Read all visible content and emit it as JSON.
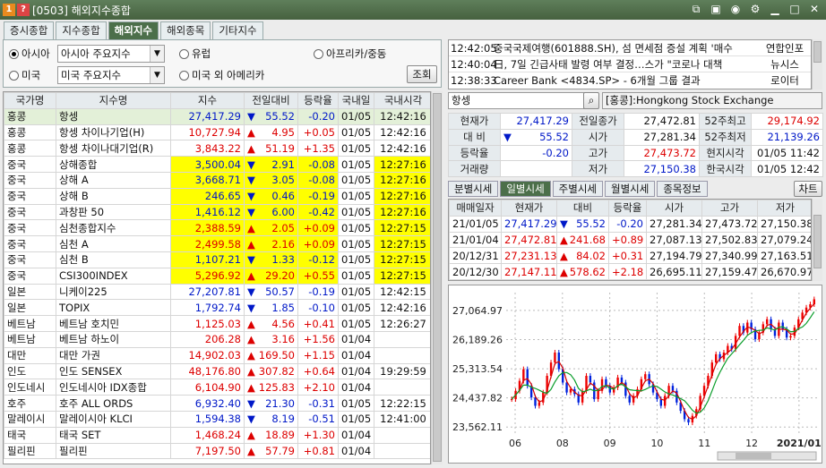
{
  "window": {
    "screen_no": "[0503]",
    "title": "해외지수종합"
  },
  "tabs": [
    "증시종합",
    "지수종합",
    "해외지수",
    "해외종목",
    "기타지수"
  ],
  "active_tab": 2,
  "regions": {
    "asia": "아시아",
    "europe": "유럽",
    "africa": "아프리카/중동",
    "usa": "미국",
    "usa_other": "미국 외 아메리카",
    "asia_select": "아시아 주요지수",
    "usa_select": "미국 주요지수",
    "query_button": "조회"
  },
  "table": {
    "headers": [
      "국가명",
      "지수명",
      "지수",
      "전일대비",
      "등락율",
      "국내일",
      "국내시각"
    ],
    "rows": [
      {
        "country": "홍콩",
        "name": "항셍",
        "value": "27,417.29",
        "dir": "down",
        "change": "55.52",
        "rate": "-0.20",
        "date": "01/05",
        "time": "12:42:16",
        "yellow": false,
        "hl": true
      },
      {
        "country": "홍콩",
        "name": "항셍 차이나기업(H)",
        "value": "10,727.94",
        "dir": "up",
        "change": "4.95",
        "rate": "+0.05",
        "date": "01/05",
        "time": "12:42:16",
        "yellow": false
      },
      {
        "country": "홍콩",
        "name": "항셍 차이나대기업(R)",
        "value": "3,843.22",
        "dir": "up",
        "change": "51.19",
        "rate": "+1.35",
        "date": "01/05",
        "time": "12:42:16",
        "yellow": false
      },
      {
        "country": "중국",
        "name": "상해종합",
        "value": "3,500.04",
        "dir": "down",
        "change": "2.91",
        "rate": "-0.08",
        "date": "01/05",
        "time": "12:27:16",
        "yellow": true
      },
      {
        "country": "중국",
        "name": "상해 A",
        "value": "3,668.71",
        "dir": "down",
        "change": "3.05",
        "rate": "-0.08",
        "date": "01/05",
        "time": "12:27:16",
        "yellow": true
      },
      {
        "country": "중국",
        "name": "상해 B",
        "value": "246.65",
        "dir": "down",
        "change": "0.46",
        "rate": "-0.19",
        "date": "01/05",
        "time": "12:27:16",
        "yellow": true
      },
      {
        "country": "중국",
        "name": "과창판 50",
        "value": "1,416.12",
        "dir": "down",
        "change": "6.00",
        "rate": "-0.42",
        "date": "01/05",
        "time": "12:27:16",
        "yellow": true
      },
      {
        "country": "중국",
        "name": "심천종합지수",
        "value": "2,388.59",
        "dir": "up",
        "change": "2.05",
        "rate": "+0.09",
        "date": "01/05",
        "time": "12:27:15",
        "yellow": true
      },
      {
        "country": "중국",
        "name": "심천 A",
        "value": "2,499.58",
        "dir": "up",
        "change": "2.16",
        "rate": "+0.09",
        "date": "01/05",
        "time": "12:27:15",
        "yellow": true
      },
      {
        "country": "중국",
        "name": "심천 B",
        "value": "1,107.21",
        "dir": "down",
        "change": "1.33",
        "rate": "-0.12",
        "date": "01/05",
        "time": "12:27:15",
        "yellow": true
      },
      {
        "country": "중국",
        "name": "CSI300INDEX",
        "value": "5,296.92",
        "dir": "up",
        "change": "29.20",
        "rate": "+0.55",
        "date": "01/05",
        "time": "12:27:15",
        "yellow": true
      },
      {
        "country": "일본",
        "name": "니케이225",
        "value": "27,207.81",
        "dir": "down",
        "change": "50.57",
        "rate": "-0.19",
        "date": "01/05",
        "time": "12:42:15",
        "yellow": false
      },
      {
        "country": "일본",
        "name": "TOPIX",
        "value": "1,792.74",
        "dir": "down",
        "change": "1.85",
        "rate": "-0.10",
        "date": "01/05",
        "time": "12:42:16",
        "yellow": false
      },
      {
        "country": "베트남",
        "name": "베트남 호치민",
        "value": "1,125.03",
        "dir": "up",
        "change": "4.56",
        "rate": "+0.41",
        "date": "01/05",
        "time": "12:26:27",
        "yellow": false
      },
      {
        "country": "베트남",
        "name": "베트남 하노이",
        "value": "206.28",
        "dir": "up",
        "change": "3.16",
        "rate": "+1.56",
        "date": "01/04",
        "time": "",
        "yellow": false
      },
      {
        "country": "대만",
        "name": "대만 가권",
        "value": "14,902.03",
        "dir": "up",
        "change": "169.50",
        "rate": "+1.15",
        "date": "01/04",
        "time": "",
        "yellow": false
      },
      {
        "country": "인도",
        "name": "인도 SENSEX",
        "value": "48,176.80",
        "dir": "up",
        "change": "307.82",
        "rate": "+0.64",
        "date": "01/04",
        "time": "19:29:59",
        "yellow": false
      },
      {
        "country": "인도네시",
        "name": "인도네시아 IDX종합",
        "value": "6,104.90",
        "dir": "up",
        "change": "125.83",
        "rate": "+2.10",
        "date": "01/04",
        "time": "",
        "yellow": false
      },
      {
        "country": "호주",
        "name": "호주 ALL ORDS",
        "value": "6,932.40",
        "dir": "down",
        "change": "21.30",
        "rate": "-0.31",
        "date": "01/05",
        "time": "12:22:15",
        "yellow": false
      },
      {
        "country": "말레이시",
        "name": "말레이시아 KLCI",
        "value": "1,594.38",
        "dir": "down",
        "change": "8.19",
        "rate": "-0.51",
        "date": "01/05",
        "time": "12:41:00",
        "yellow": false
      },
      {
        "country": "태국",
        "name": "태국 SET",
        "value": "1,468.24",
        "dir": "up",
        "change": "18.89",
        "rate": "+1.30",
        "date": "01/04",
        "time": "",
        "yellow": false
      },
      {
        "country": "필리핀",
        "name": "필리핀",
        "value": "7,197.50",
        "dir": "up",
        "change": "57.79",
        "rate": "+0.81",
        "date": "01/04",
        "time": "",
        "yellow": false
      }
    ]
  },
  "news": [
    {
      "time": "12:42:05",
      "headline": "중국국제여행(601888.SH), 섬 면세점 증설 계획 '매수",
      "source": "연합인포"
    },
    {
      "time": "12:40:04",
      "headline": "日, 7일 긴급사태 발령 여부 결정…스가 \"코로나 대책",
      "source": "뉴시스"
    },
    {
      "time": "12:38:33",
      "headline": "Career Bank <4834.SP> - 6개월 그룹 결과",
      "source": "로이터"
    }
  ],
  "detail": {
    "search_value": "항셍",
    "exchange": "[홍콩]:Hongkong Stock Exchange",
    "labels": {
      "cur": "현재가",
      "diff": "대 비",
      "rate": "등락율",
      "vol": "거래량",
      "prev": "전일종가",
      "open": "시가",
      "high": "고가",
      "low": "저가",
      "w52h": "52주최고",
      "w52l": "52주최저",
      "local": "현지시각",
      "kr": "한국시각"
    },
    "cur": "27,417.29",
    "diff": "55.52",
    "rate": "-0.20",
    "vol": "",
    "prev": "27,472.81",
    "open": "27,281.34",
    "high": "27,473.72",
    "low": "27,150.38",
    "w52h": "29,174.92",
    "w52l": "21,139.26",
    "local": "01/05 11:42",
    "kr": "01/05 12:42"
  },
  "subtabs": [
    "분별시세",
    "일별시세",
    "주별시세",
    "월별시세",
    "종목정보"
  ],
  "active_subtab": 1,
  "chart_button": "차트",
  "daily": {
    "headers": [
      "매매일자",
      "현재가",
      "대비",
      "등락율",
      "시가",
      "고가",
      "저가"
    ],
    "rows": [
      {
        "date": "21/01/05",
        "cur": "27,417.29",
        "dir": "down",
        "diff": "55.52",
        "rate": "-0.20",
        "open": "27,281.34",
        "high": "27,473.72",
        "low": "27,150.38"
      },
      {
        "date": "21/01/04",
        "cur": "27,472.81",
        "dir": "up",
        "diff": "241.68",
        "rate": "+0.89",
        "open": "27,087.13",
        "high": "27,502.83",
        "low": "27,079.24"
      },
      {
        "date": "20/12/31",
        "cur": "27,231.13",
        "dir": "up",
        "diff": "84.02",
        "rate": "+0.31",
        "open": "27,194.79",
        "high": "27,340.99",
        "low": "27,163.51"
      },
      {
        "date": "20/12/30",
        "cur": "27,147.11",
        "dir": "up",
        "diff": "578.62",
        "rate": "+2.18",
        "open": "26,695.11",
        "high": "27,159.47",
        "low": "26,670.97"
      }
    ]
  },
  "chart_data": {
    "type": "line",
    "ylabels": [
      "27,064.97",
      "26,189.26",
      "25,313.54",
      "24,437.82",
      "23,562.11"
    ],
    "ylim": [
      23300,
      27600
    ],
    "xlabels": [
      "06",
      "08",
      "09",
      "10",
      "11",
      "12",
      "2021/01"
    ],
    "series": [
      {
        "values": [
          24400,
          24650,
          24950,
          25300,
          24800,
          24450,
          24200,
          24300,
          24600,
          25100,
          25500,
          25800,
          25300,
          24900,
          24600,
          24700,
          24550,
          24300,
          24650,
          25100,
          24900,
          24400,
          24650,
          25000,
          24800,
          24600,
          24750,
          25050,
          24900,
          24500,
          24300,
          24500,
          24700,
          25000,
          25150,
          24850,
          24600,
          24400,
          24200,
          24500,
          24800,
          24650,
          24300,
          24050,
          23800,
          23700,
          23900,
          24100,
          24500,
          24800,
          25100,
          25500,
          25750,
          25600,
          25800,
          26000,
          25900,
          26300,
          26600,
          26400,
          26700,
          26500,
          26200,
          26400,
          26650,
          26800,
          26500,
          26300,
          26700,
          26500,
          26250,
          26300,
          26550,
          26800,
          27000,
          27150,
          27250,
          27400
        ]
      }
    ]
  }
}
